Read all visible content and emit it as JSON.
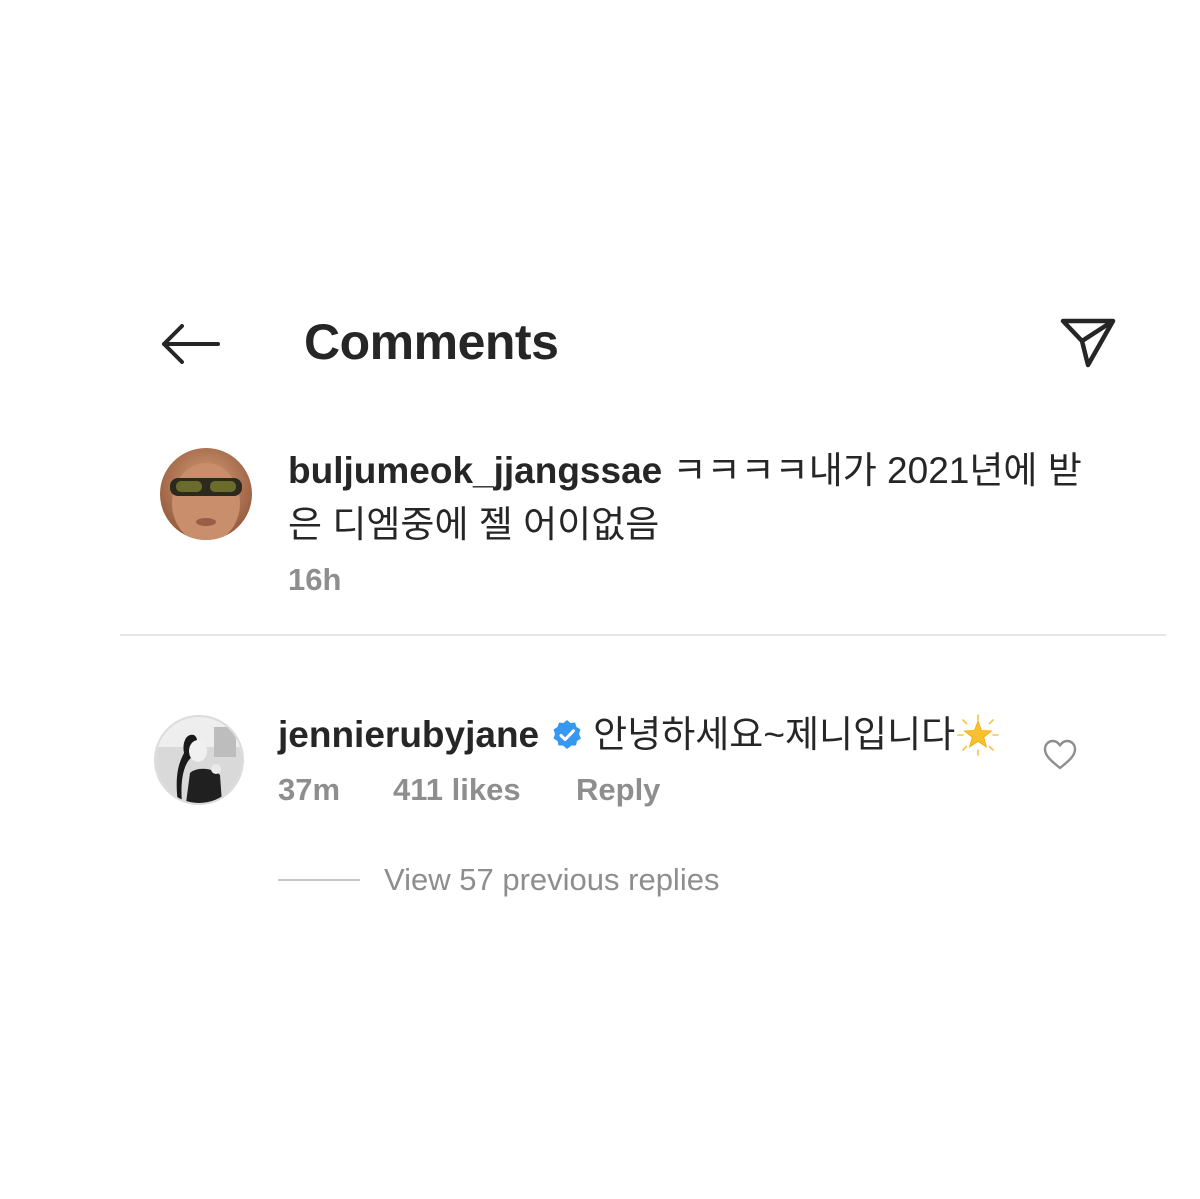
{
  "header": {
    "title": "Comments",
    "back_icon": "arrow-left-icon",
    "share_icon": "paper-plane-icon"
  },
  "comments": [
    {
      "username": "buljumeok_jjangssae",
      "text": "ㅋㅋㅋㅋ내가 2021년에 받은 디엠중에 젤 어이없음",
      "time": "16h"
    },
    {
      "username": "jenniérubyjane",
      "username_display": "jennierubyjane",
      "verified": true,
      "text": "안녕하세요~제니입니다",
      "emoji": "glowing-star-icon",
      "time": "37m",
      "likes": "411 likes",
      "reply_label": "Reply",
      "view_replies": "View 57 previous replies"
    }
  ],
  "colors": {
    "text": "#262626",
    "secondary": "#8e8e8e",
    "verified": "#3897f0",
    "divider": "#e6e6e6"
  }
}
